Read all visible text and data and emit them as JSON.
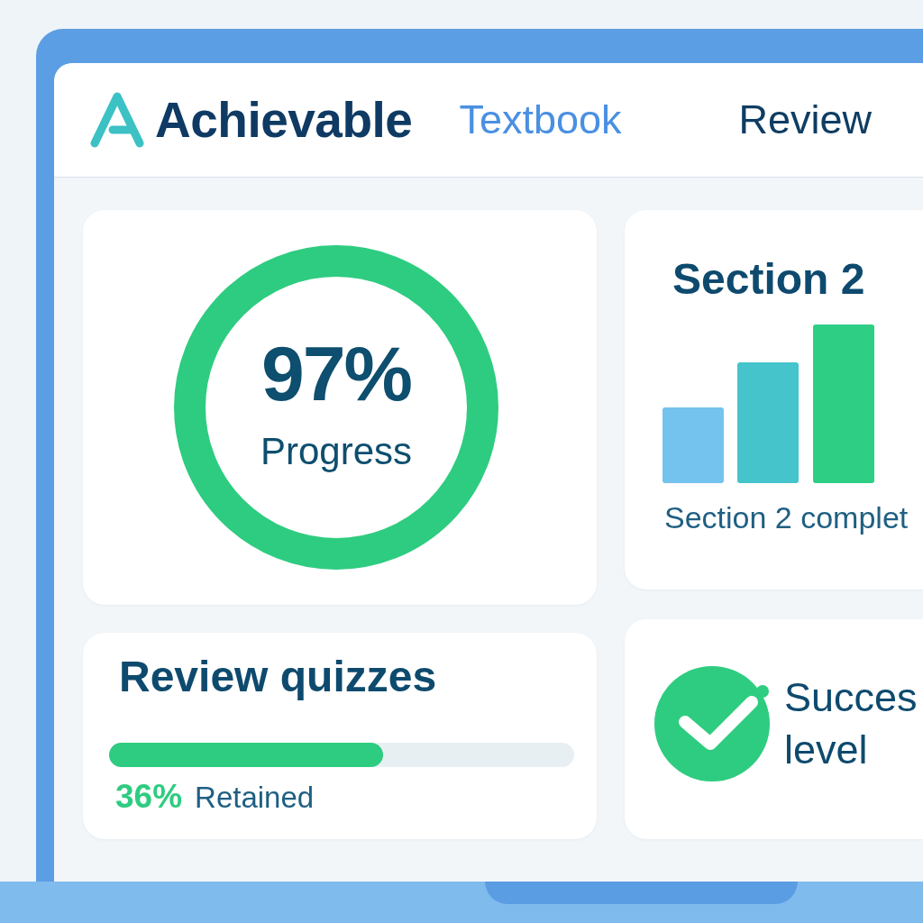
{
  "header": {
    "brand": "Achievable",
    "tabs": [
      {
        "label": "Textbook",
        "selected": true
      },
      {
        "label": "Review",
        "selected": false
      }
    ]
  },
  "progress_card": {
    "value": "97%",
    "label": "Progress"
  },
  "section_card": {
    "title": "Section 2",
    "caption": "Section 2 complet"
  },
  "quiz_card": {
    "title": "Review quizzes",
    "level": 0.59,
    "percent": "36%",
    "label": "Retained"
  },
  "success_card": {
    "title": "Succes level"
  }
}
